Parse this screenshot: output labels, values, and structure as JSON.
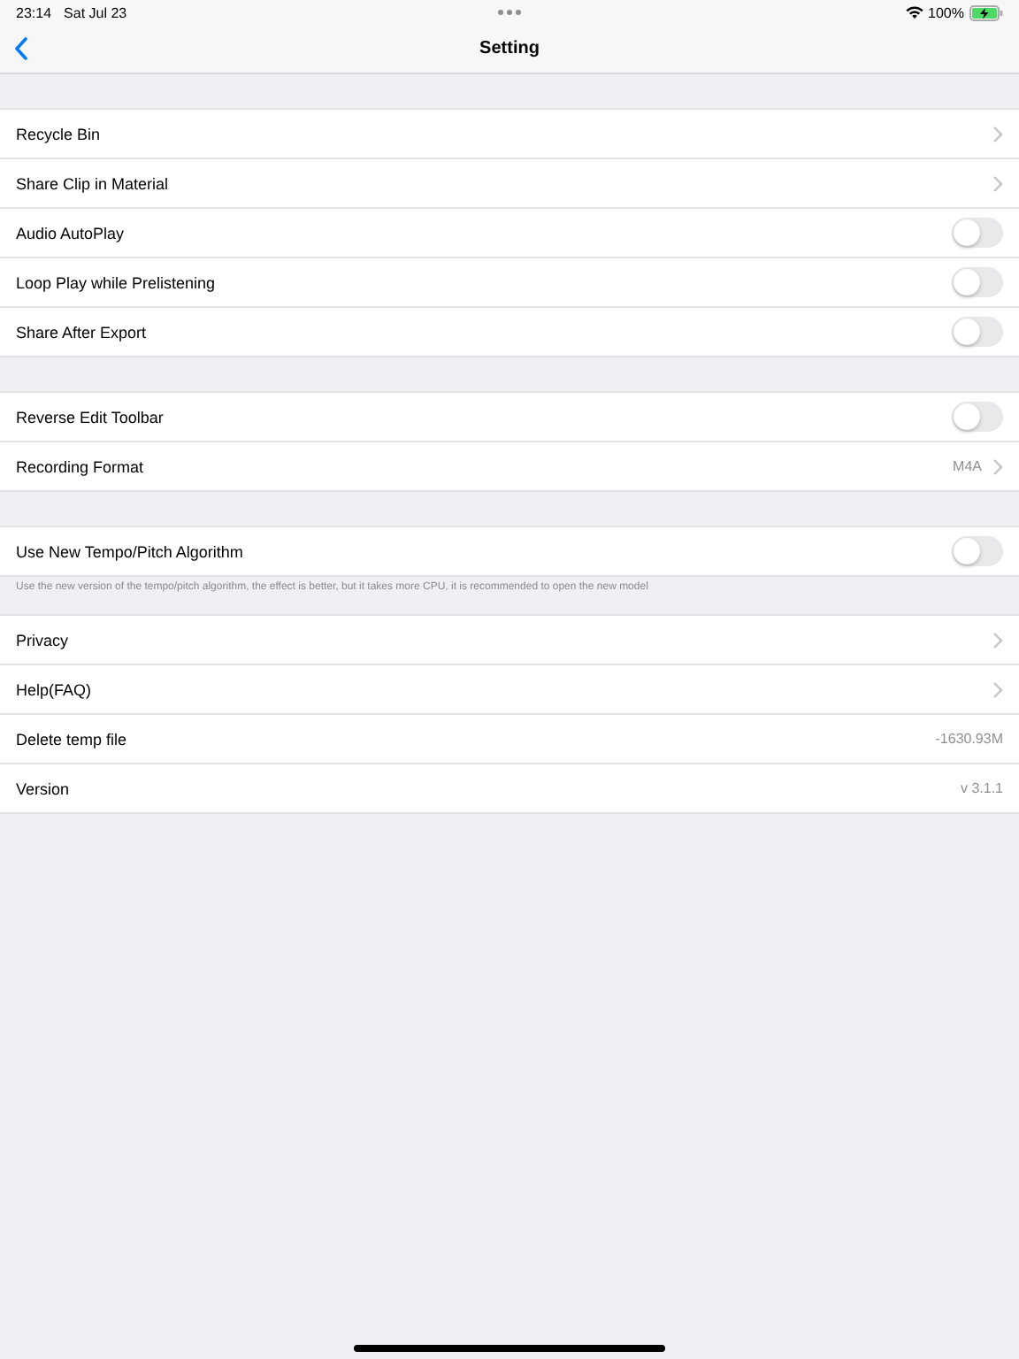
{
  "status_bar": {
    "time": "23:14",
    "date": "Sat Jul 23",
    "battery": "100%"
  },
  "nav": {
    "title": "Setting"
  },
  "groups": [
    {
      "rows": [
        {
          "kind": "link",
          "label": "Recycle Bin"
        },
        {
          "kind": "link",
          "label": "Share Clip in Material"
        },
        {
          "kind": "toggle",
          "label": "Audio AutoPlay",
          "on": false
        },
        {
          "kind": "toggle",
          "label": "Loop Play while Prelistening",
          "on": false
        },
        {
          "kind": "toggle",
          "label": "Share After Export",
          "on": false
        }
      ]
    },
    {
      "rows": [
        {
          "kind": "toggle",
          "label": "Reverse Edit Toolbar",
          "on": false
        },
        {
          "kind": "link",
          "label": "Recording Format",
          "value": "M4A"
        }
      ]
    },
    {
      "rows": [
        {
          "kind": "toggle",
          "label": "Use New Tempo/Pitch Algorithm",
          "on": false
        }
      ],
      "footer": "Use the new version of the tempo/pitch algorithm, the effect is better, but it takes more CPU, it is recommended to open the new model"
    },
    {
      "rows": [
        {
          "kind": "link",
          "label": "Privacy"
        },
        {
          "kind": "link",
          "label": "Help(FAQ)"
        },
        {
          "kind": "value",
          "label": "Delete temp file",
          "value": "-1630.93M"
        },
        {
          "kind": "value",
          "label": "Version",
          "value": "v 3.1.1"
        }
      ]
    }
  ]
}
